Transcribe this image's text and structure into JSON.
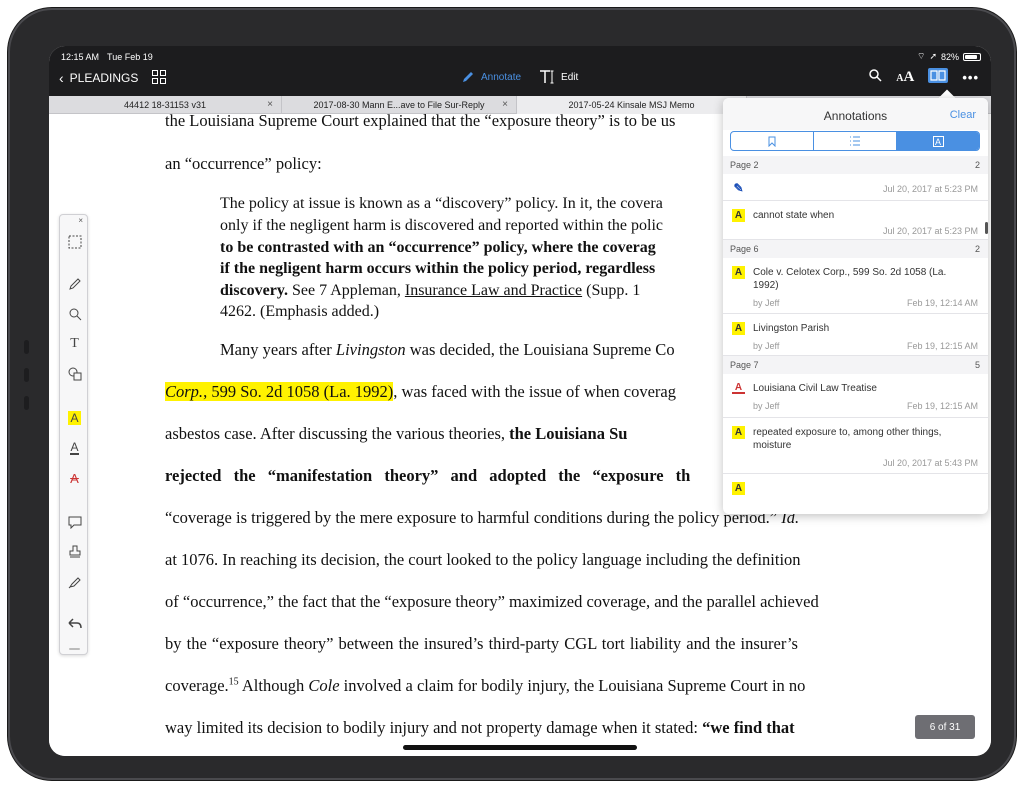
{
  "status": {
    "time": "12:15 AM",
    "date": "Tue Feb 19",
    "battery": "82%"
  },
  "nav": {
    "back_label": "PLEADINGS",
    "annotate_label": "Annotate",
    "edit_label": "Edit"
  },
  "tabs": [
    {
      "label": "44412 18-31153 v31"
    },
    {
      "label": "2017-08-30 Mann E...ave to File Sur-Reply"
    },
    {
      "label": "2017-05-24 Kinsale MSJ Memo"
    }
  ],
  "doc": {
    "l1": "the Louisiana Supreme Court explained that the “exposure theory” is to be us",
    "l2": "an “occurrence” policy:",
    "q1": "The policy at issue is known as a “discovery” policy.  In it, the covera",
    "q2": "only if the negligent harm is discovered and reported within the polic",
    "q3": "to be contrasted with an “occurrence” policy, where the coverag",
    "q4": "if the negligent harm occurs within the policy period, regardless",
    "q5a": "discovery.",
    "q5b": "  See 7 Appleman, ",
    "q5c": "Insurance Law and Practice",
    "q5d": " (Supp. 1",
    "q6": "4262.  (Emphasis added.)",
    "p1a": "Many years after ",
    "p1b": "Livingston",
    "p1c": " was decided, the Louisiana Supreme Co",
    "p2a": "Corp.",
    "p2b": ", 599 So. 2d 1058 (La. 1992)",
    "p2c": ", was faced with the issue of when coverag",
    "p3a": "asbestos case.   After discussing the various theories, ",
    "p3b": "the Louisiana Su",
    "p4": "rejected the “manifestation theory” and adopted the “exposure th",
    "p5a": "“coverage is triggered by the mere exposure to harmful conditions during the policy period.” ",
    "p5b": "Id.",
    "p6": "at 1076.  In reaching its decision, the court looked to the policy language including the definition",
    "p7": "of “occurrence,” the fact that the “exposure theory” maximized coverage, and the parallel achieved",
    "p8": "by the “exposure theory” between the insured’s third-party CGL tort liability and the insurer’s",
    "p9a": "coverage.",
    "p9sup": "15",
    "p9b": "  Although ",
    "p9c": "Cole",
    "p9d": " involved a claim for bodily injury, the Louisiana Supreme Court in no",
    "p10a": "way limited its decision to bodily injury and not property damage when it stated: ",
    "p10b": "“we find that"
  },
  "palette": {
    "close": "×",
    "items": [
      "select-icon",
      "pen-icon",
      "eraser-icon",
      "text-icon",
      "shapes-icon",
      "highlight-icon",
      "underline-icon",
      "strikeout-icon",
      "note-icon",
      "stamp-icon",
      "signature-icon",
      "undo-icon"
    ]
  },
  "annotations": {
    "title": "Annotations",
    "clear": "Clear",
    "sections": [
      {
        "page": "Page 2",
        "count": "2"
      },
      {
        "page": "Page 6",
        "count": "2"
      },
      {
        "page": "Page 7",
        "count": "5"
      }
    ],
    "items": [
      {
        "icon": "pen",
        "text": "",
        "by": "",
        "date": "Jul 20, 2017 at 5:23 PM"
      },
      {
        "icon": "highlight",
        "text": "cannot state when",
        "by": "",
        "date": "Jul 20, 2017 at 5:23 PM"
      },
      {
        "icon": "highlight",
        "text": "Cole v. Celotex Corp., 599 So. 2d 1058 (La. 1992)",
        "by": "by Jeff",
        "date": "Feb 19, 12:14 AM"
      },
      {
        "icon": "highlight",
        "text": "Livingston Parish",
        "by": "by Jeff",
        "date": "Feb 19, 12:15 AM"
      },
      {
        "icon": "underline",
        "text": "Louisiana Civil Law Treatise",
        "by": "by Jeff",
        "date": "Feb 19, 12:15 AM"
      },
      {
        "icon": "highlight",
        "text": "repeated exposure to, among other things, moisture",
        "by": "",
        "date": "Jul 20, 2017 at 5:43 PM"
      }
    ]
  },
  "page_indicator": "6 of 31"
}
